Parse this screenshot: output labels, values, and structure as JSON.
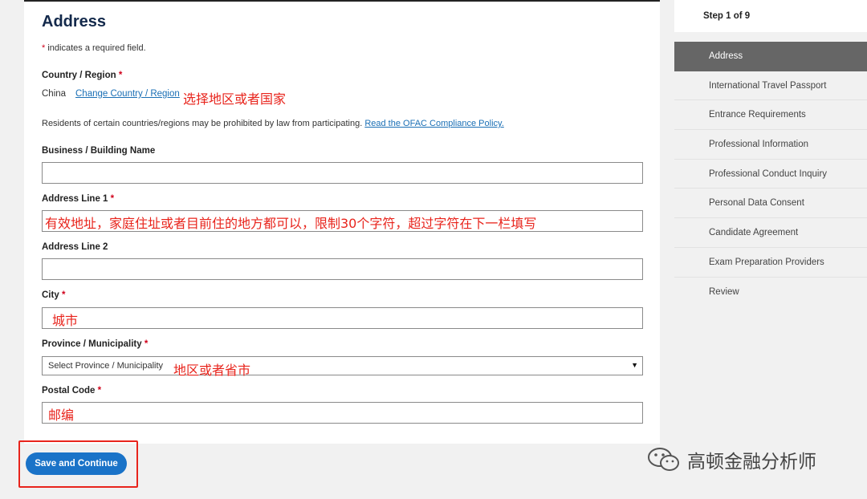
{
  "form": {
    "title": "Address",
    "required_note": "indicates a required field.",
    "required_star": "*",
    "country": {
      "label": "Country / Region",
      "value": "China",
      "change_link": "Change Country / Region",
      "annotation": "选择地区或者国家"
    },
    "residents_note": "Residents of certain countries/regions may be prohibited by law from participating.",
    "ofac_link": "Read the OFAC Compliance Policy.",
    "business": {
      "label": "Business / Building Name",
      "value": ""
    },
    "address1": {
      "label": "Address Line 1",
      "annotation": "有效地址，家庭住址或者目前住的地方都可以，限制30个字符，超过字符在下一栏填写"
    },
    "address2": {
      "label": "Address Line 2",
      "value": ""
    },
    "city": {
      "label": "City",
      "annotation": "城市"
    },
    "province": {
      "label": "Province / Municipality",
      "selected": "Select Province / Municipality",
      "annotation": "地区或者省市"
    },
    "postal": {
      "label": "Postal Code",
      "annotation": "邮编"
    }
  },
  "actions": {
    "save_label": "Save and Continue"
  },
  "steps": {
    "header": "Step 1 of 9",
    "items": [
      "Address",
      "International Travel Passport",
      "Entrance Requirements",
      "Professional Information",
      "Professional Conduct Inquiry",
      "Personal Data Consent",
      "Candidate Agreement",
      "Exam Preparation Providers",
      "Review"
    ],
    "active_index": 0
  },
  "watermark": {
    "text": "高顿金融分析师",
    "icon": "wechat-icon"
  },
  "colors": {
    "accent": "#1a73c8",
    "annotation": "#e8241c",
    "title": "#13294b",
    "active_step": "#666666"
  }
}
